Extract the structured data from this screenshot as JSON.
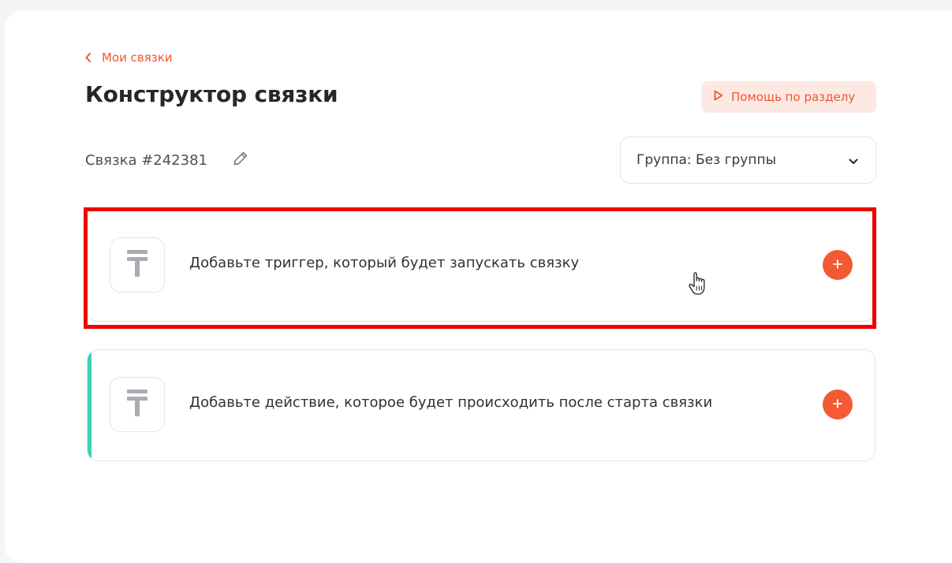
{
  "nav": {
    "back_label": "Мои связки"
  },
  "header": {
    "title": "Конструктор связки",
    "help_label": "Помощь по разделу"
  },
  "link": {
    "name": "Связка #242381"
  },
  "group_select": {
    "selected": "Группа: Без группы"
  },
  "steps": [
    {
      "type": "trigger",
      "text": "Добавьте триггер, который будет запускать связку"
    },
    {
      "type": "action",
      "text": "Добавьте действие, которое будет происходить после старта связки"
    }
  ],
  "colors": {
    "accent": "#f0552f",
    "accent_bg": "#fde9e3",
    "action_stripe": "#3dcfb6",
    "highlight": "#ee0000"
  },
  "icons": {
    "back": "chevron-left-icon",
    "help": "play-icon",
    "edit": "pencil-icon",
    "dropdown": "chevron-down-icon",
    "service": "service-placeholder-icon",
    "add": "plus-icon"
  }
}
